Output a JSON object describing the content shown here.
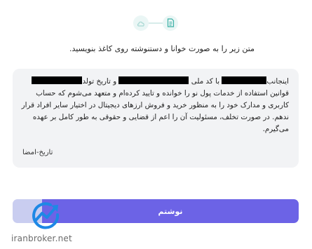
{
  "steps": [
    {
      "icon": "cloud-icon"
    },
    {
      "icon": "document-icon"
    }
  ],
  "instruction": "متن زیر را به صورت خوانا و دستنوشته روی کاغذ بنویسید.",
  "statement": {
    "part1": "اینجانب",
    "part2": "با کد ملی",
    "part3": "و تاریخ تولد",
    "part4": "قوانین استفاده از خدمات پول نو را خوانده و تایید کرده‌ام و متعهد می‌شوم که حساب کاربری و مدارک خود را به منظور خرید و فروش ارزهای دیجیتال در اختیار سایر افراد قرار ندهم. در صورت تخلف، مسئولیت آن را اعم از قضایی و حقوقی به طور کامل بر عهده می‌گیرم.",
    "signature": "تاریخ-امضا"
  },
  "submit_button": {
    "label": "نوشتم"
  },
  "watermark": {
    "text": "iranbroker.net"
  },
  "colors": {
    "accent": "#6c63e6",
    "step_bg": "#eaf6f5",
    "step_icon": "#3bb0a5",
    "card_bg": "#f2f3f5",
    "watermark_logo": "#1e88e5"
  }
}
